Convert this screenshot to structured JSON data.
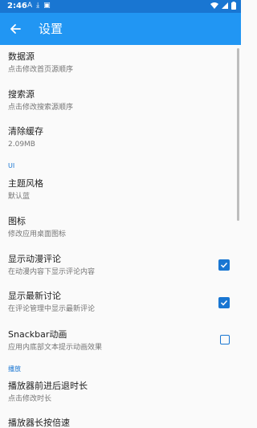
{
  "status_bar": {
    "time": "2:46"
  },
  "toolbar": {
    "title": "设置"
  },
  "prefs": {
    "data_source": {
      "title": "数据源",
      "summary": "点击修改首页源顺序"
    },
    "search_source": {
      "title": "搜索源",
      "summary": "点击修改搜索源顺序"
    },
    "clear_cache": {
      "title": "清除缓存",
      "summary": "2.09MB"
    },
    "ui_category": "UI",
    "theme_style": {
      "title": "主题风格",
      "summary": "默认蓝"
    },
    "icon": {
      "title": "图标",
      "summary": "修改应用桌面图标"
    },
    "show_anime_comments": {
      "title": "显示动漫评论",
      "summary": "在动漫内容下显示评论内容",
      "checked": true
    },
    "show_latest_discussion": {
      "title": "显示最新讨论",
      "summary": "在评论管理中显示最新评论",
      "checked": true
    },
    "snackbar_animation": {
      "title": "Snackbar动画",
      "summary": "应用内底部文本提示动画效果",
      "checked": false
    },
    "player_category": "播放",
    "seek_duration": {
      "title": "播放器前进后退时长",
      "summary": "点击修改时长"
    },
    "long_press_speed": {
      "title": "播放器长按倍速"
    }
  },
  "colors": {
    "primary": "#2196f3",
    "primary_dark": "#1976d2",
    "accent": "#1976d2"
  }
}
